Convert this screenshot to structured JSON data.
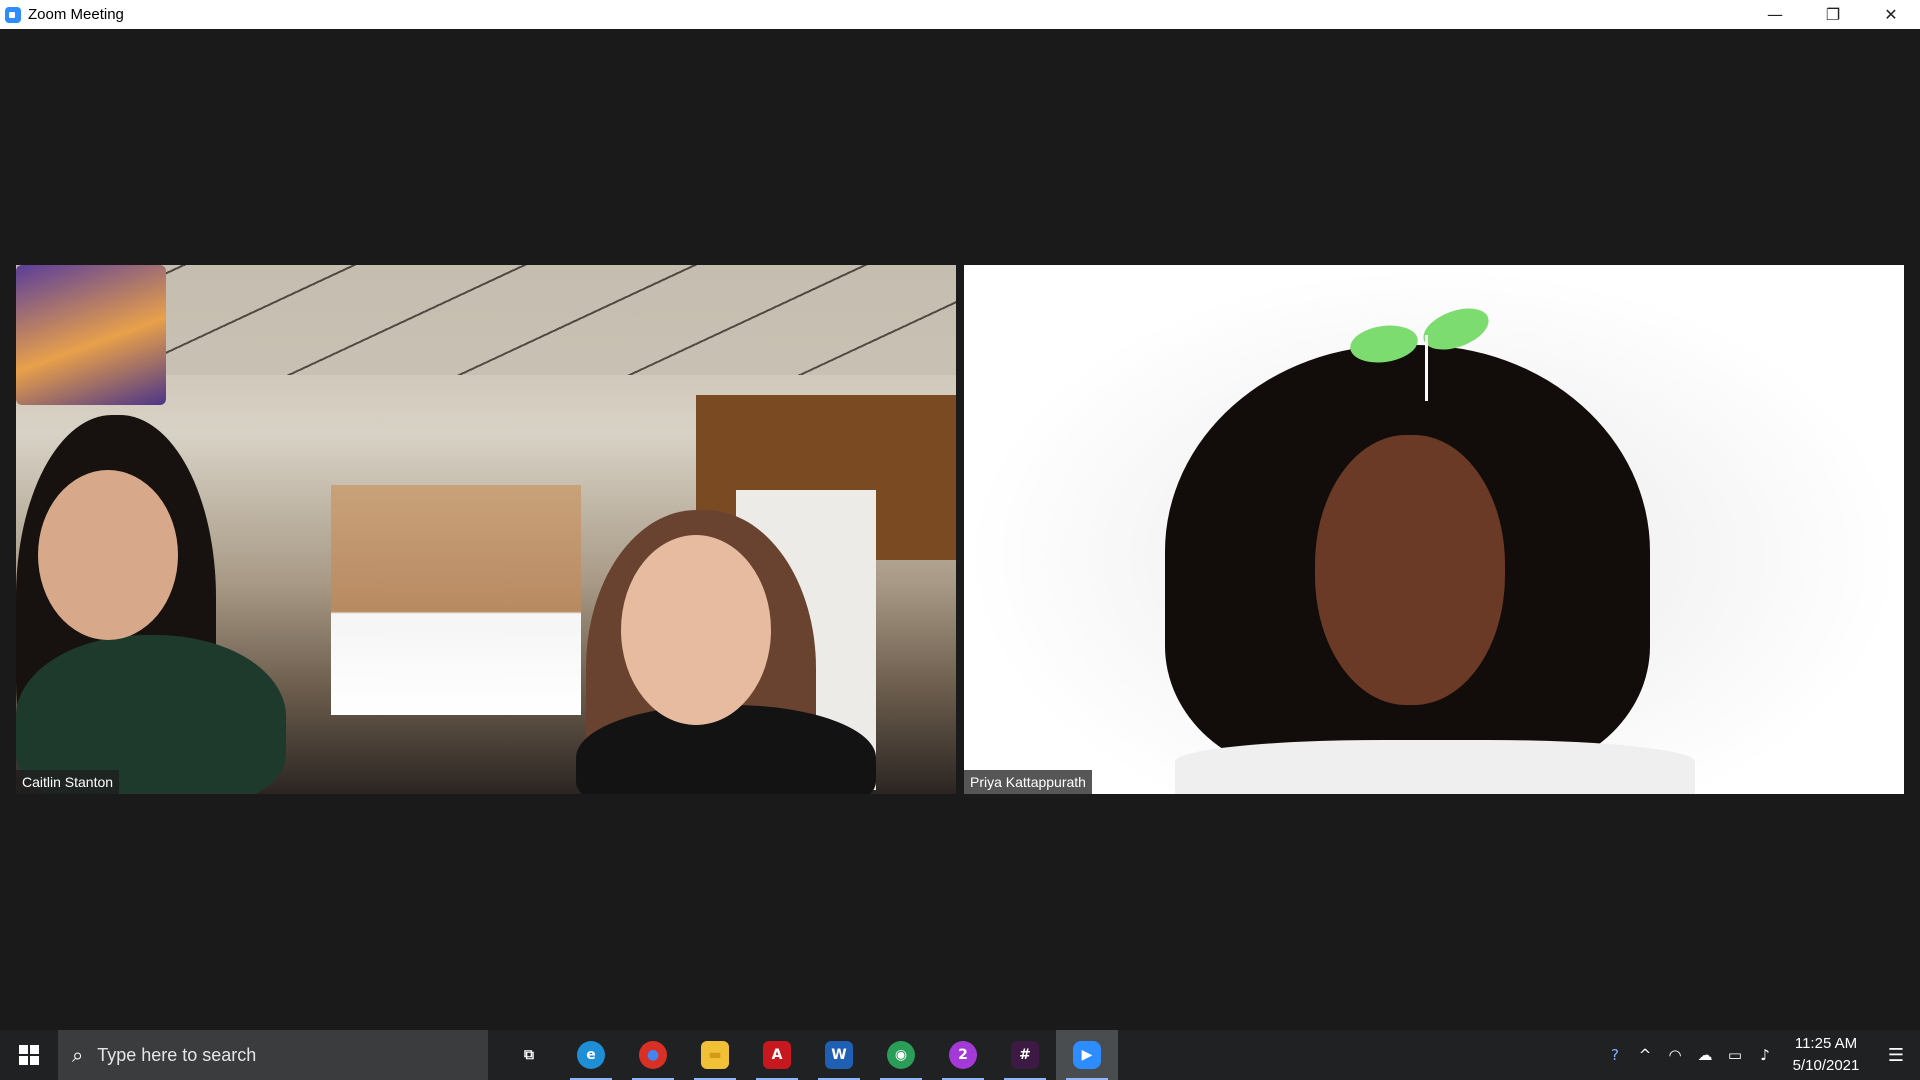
{
  "window": {
    "title": "Zoom Meeting",
    "minimize_glyph": "—",
    "restore_glyph": "❐",
    "close_glyph": "✕"
  },
  "meeting": {
    "participants": [
      {
        "name": "Caitlin Stanton"
      },
      {
        "name": "Priya Kattappurath"
      }
    ]
  },
  "taskbar": {
    "search_placeholder": "Type here to search",
    "search_icon_glyph": "⌕",
    "apps": [
      {
        "icon": "task-view-icon",
        "glyph": "⧉",
        "color": "#1f2122"
      },
      {
        "icon": "edge-icon",
        "glyph": "e",
        "color": "#1e8fd6"
      },
      {
        "icon": "chrome-icon",
        "glyph": "●",
        "color": "#d93025"
      },
      {
        "icon": "file-explorer-icon",
        "glyph": "▬",
        "color": "#f2c037"
      },
      {
        "icon": "acrobat-icon",
        "glyph": "A",
        "color": "#c7181f"
      },
      {
        "icon": "word-icon",
        "glyph": "W",
        "color": "#1f5fb4"
      },
      {
        "icon": "maps-icon",
        "glyph": "◉",
        "color": "#2a9e58"
      },
      {
        "icon": "messenger-icon",
        "glyph": "2",
        "color": "#a33ad8"
      },
      {
        "icon": "slack-icon",
        "glyph": "#",
        "color": "#3c1a44"
      },
      {
        "icon": "zoom-icon",
        "glyph": "▶",
        "color": "#2d8cff"
      }
    ],
    "tray": {
      "help_glyph": "?",
      "chevron_glyph": "^",
      "network_glyph": "◠",
      "cloud_glyph": "☁",
      "battery_glyph": "▭",
      "volume_glyph": "♪",
      "notification_glyph": "☰",
      "time": "11:25 AM",
      "date": "5/10/2021"
    }
  }
}
